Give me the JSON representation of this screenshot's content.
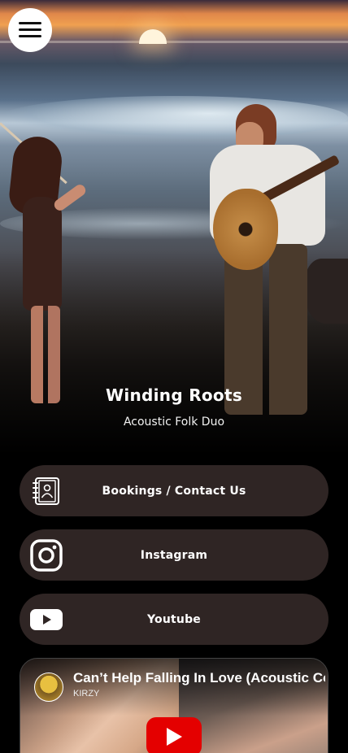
{
  "header": {
    "menu_icon": "hamburger-menu-icon",
    "band_name": "Winding Roots",
    "tagline": "Acoustic Folk Duo"
  },
  "links": [
    {
      "label": "Bookings / Contact Us",
      "icon": "contact-book-icon"
    },
    {
      "label": "Instagram",
      "icon": "instagram-icon"
    },
    {
      "label": "Youtube",
      "icon": "youtube-icon"
    }
  ],
  "video": {
    "title": "Can’t Help Falling In Love (Acoustic Cover)",
    "channel": "KIRZY",
    "play_icon": "youtube-play-icon"
  },
  "colors": {
    "button_bg": "#2f2524",
    "background": "#000000",
    "play_red": "#e40000"
  }
}
